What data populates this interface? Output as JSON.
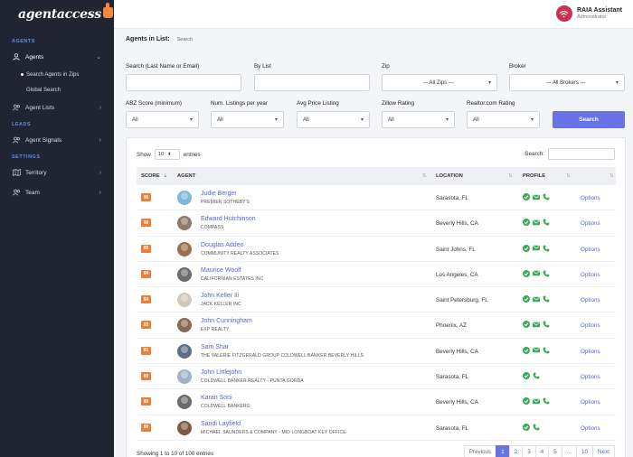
{
  "brand": {
    "logo_text": "agentaccess"
  },
  "sidebar": {
    "sections": {
      "agents": "AGENTS",
      "leads": "LEADS",
      "settings": "SETTINGS"
    },
    "items": {
      "agents": "Agents",
      "search_in_zips": "Search Agents in Zips",
      "global_search": "Global Search",
      "agent_lists": "Agent Lists",
      "agent_signals": "Agent Signals",
      "territory": "Territory",
      "team": "Team"
    }
  },
  "user": {
    "name": "RAIA Assistant",
    "role": "Administrator"
  },
  "breadcrumb": {
    "title": "Agents in List:",
    "current": "Search"
  },
  "filters": {
    "search_label": "Search (Last Name or Email)",
    "search_value": "",
    "bylist_label": "By List",
    "bylist_value": "",
    "zip_label": "Zip",
    "zip_value": "--- All Zips ---",
    "broker_label": "Broker",
    "broker_value": "--- All Brokers ---",
    "abz_label": "ABZ Score (minimum)",
    "abz_value": "All",
    "listings_label": "Num. Listings per year",
    "listings_value": "All",
    "price_label": "Avg Price Listing",
    "price_value": "All",
    "zillow_label": "Zillow Rating",
    "zillow_value": "All",
    "realtor_label": "Realtor.com Rating",
    "realtor_value": "All",
    "search_button": "Search"
  },
  "table": {
    "show_label": "Show",
    "entries_value": "10",
    "entries_label": "entries",
    "search_label": "Search:",
    "headers": {
      "score": "SCORE",
      "agent": "AGENT",
      "location": "LOCATION",
      "profile": "PROFILE"
    },
    "options_label": "Options",
    "rows": [
      {
        "score": "90",
        "name": "Judie Berger",
        "company": "PREMIER SOTHEBY'S",
        "location": "Sarasota, FL",
        "phone_only": false,
        "avatar_color": "#7fb8d9"
      },
      {
        "score": "90",
        "name": "Edward Hutchinson",
        "company": "COMPASS",
        "location": "Beverly Hills, CA",
        "phone_only": false,
        "avatar_color": "#8c7a6b"
      },
      {
        "score": "85",
        "name": "Douglas Addeo",
        "company": "COMMUNITY REALTY ASSOCIATES",
        "location": "Saint Johns, FL",
        "phone_only": false,
        "avatar_color": "#9a6e4e"
      },
      {
        "score": "84",
        "name": "Maurice Woolf",
        "company": "CALIFORNIAN ESTATES INC",
        "location": "Los Angeles, CA",
        "phone_only": false,
        "avatar_color": "#6b6b6b"
      },
      {
        "score": "84",
        "name": "John Keller Iii",
        "company": "JACK KELLER INC",
        "location": "Saint Petersburg, FL",
        "phone_only": false,
        "avatar_color": "#cfc8bb"
      },
      {
        "score": "83",
        "name": "John Cunningham",
        "company": "EXP REALTY",
        "location": "Phoenix, AZ",
        "phone_only": false,
        "avatar_color": "#8a6a55"
      },
      {
        "score": "81",
        "name": "Sam Shar",
        "company": "THE VALERIE FITZGERALD GROUP COLDWELL BANKER BEVERLY HILLS",
        "location": "Beverly Hills, CA",
        "phone_only": false,
        "avatar_color": "#5c6f86"
      },
      {
        "score": "80",
        "name": "John Littlejohn",
        "company": "COLDWELL BANKER REALTY - PUNTA GORDA",
        "location": "Sarasota, FL",
        "phone_only": true,
        "avatar_color": "#9fb3c8"
      },
      {
        "score": "80",
        "name": "Karan Soni",
        "company": "COLDWELL BANKERS",
        "location": "Beverly Hills, CA",
        "phone_only": false,
        "avatar_color": "#6b6b6b"
      },
      {
        "score": "80",
        "name": "Sandi Layfield",
        "company": "MICHAEL SAUNDERS & COMPANY - MID LONGBOAT KEY OFFICE",
        "location": "Sarasota, FL",
        "phone_only": true,
        "avatar_color": "#7a5a45"
      }
    ],
    "info": "Showing 1 to 10 of 100 entries",
    "pagination": {
      "prev": "Previous",
      "pages": [
        "1",
        "2",
        "3",
        "4",
        "5"
      ],
      "ellipsis": "...",
      "last": "10",
      "next": "Next",
      "active": "1"
    }
  },
  "colors": {
    "accent": "#6773e6",
    "score_badge": "#e8803a",
    "link": "#5864d8",
    "sidebar_bg": "#1f2532",
    "profile_green": "#3daa55"
  }
}
